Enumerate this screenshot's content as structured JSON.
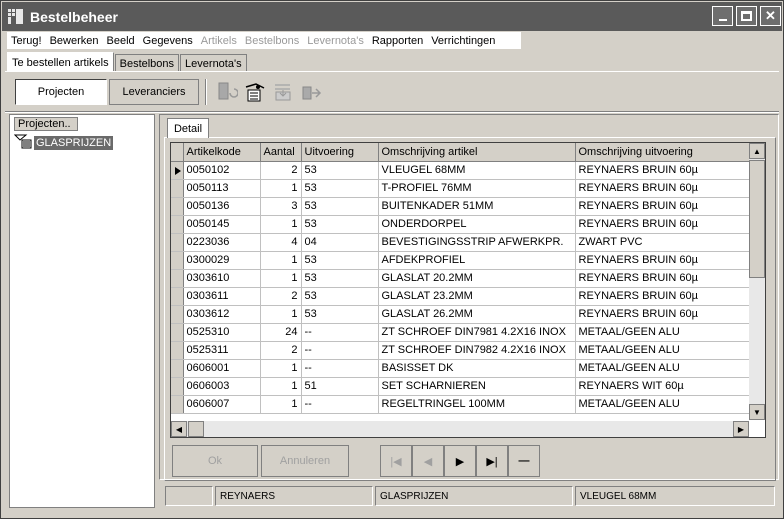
{
  "window": {
    "title": "Bestelbeheer"
  },
  "menu": [
    {
      "label": "Terug!",
      "enabled": true
    },
    {
      "label": "Bewerken",
      "enabled": true
    },
    {
      "label": "Beeld",
      "enabled": true
    },
    {
      "label": "Gegevens",
      "enabled": true
    },
    {
      "label": "Artikels",
      "enabled": false
    },
    {
      "label": "Bestelbons",
      "enabled": false
    },
    {
      "label": "Levernota's",
      "enabled": false
    },
    {
      "label": "Rapporten",
      "enabled": true
    },
    {
      "label": "Verrichtingen",
      "enabled": true
    }
  ],
  "main_tabs": [
    {
      "label": "Te bestellen artikels",
      "active": true
    },
    {
      "label": "Bestelbons",
      "active": false
    },
    {
      "label": "Levernota's",
      "active": false
    }
  ],
  "toolbar": {
    "projecten": "Projecten",
    "leveranciers": "Leveranciers",
    "icons": [
      "add-to-order-icon",
      "order-list-icon",
      "import-icon",
      "send-icon"
    ]
  },
  "tree": {
    "header": "Projecten..",
    "nodes": [
      {
        "label": "GLASPRIJZEN",
        "icon": "project-folder-icon"
      }
    ]
  },
  "detail_tab": "Detail",
  "grid": {
    "columns": [
      "Artikelkode",
      "Aantal",
      "Uitvoering",
      "Omschrijving artikel",
      "Omschrijving uitvoering"
    ],
    "rows": [
      [
        "0050102",
        "2",
        "53",
        "VLEUGEL 68MM",
        "REYNAERS BRUIN 60µ"
      ],
      [
        "0050113",
        "1",
        "53",
        "T-PROFIEL 76MM",
        "REYNAERS BRUIN 60µ"
      ],
      [
        "0050136",
        "3",
        "53",
        "BUITENKADER 51MM",
        "REYNAERS BRUIN 60µ"
      ],
      [
        "0050145",
        "1",
        "53",
        "ONDERDORPEL",
        "REYNAERS BRUIN 60µ"
      ],
      [
        "0223036",
        "4",
        "04",
        "BEVESTIGINGSSTRIP AFWERKPR.",
        "ZWART PVC"
      ],
      [
        "0300029",
        "1",
        "53",
        "AFDEKPROFIEL",
        "REYNAERS BRUIN 60µ"
      ],
      [
        "0303610",
        "1",
        "53",
        "GLASLAT 20.2MM",
        "REYNAERS BRUIN 60µ"
      ],
      [
        "0303611",
        "2",
        "53",
        "GLASLAT 23.2MM",
        "REYNAERS BRUIN 60µ"
      ],
      [
        "0303612",
        "1",
        "53",
        "GLASLAT 26.2MM",
        "REYNAERS BRUIN 60µ"
      ],
      [
        "0525310",
        "24",
        "--",
        "ZT SCHROEF DIN7981 4.2X16 INOX",
        "METAAL/GEEN ALU"
      ],
      [
        "0525311",
        "2",
        "--",
        "ZT SCHROEF DIN7982 4.2X16 INOX",
        "METAAL/GEEN ALU"
      ],
      [
        "0606001",
        "1",
        "--",
        "BASISSET DK",
        "METAAL/GEEN ALU"
      ],
      [
        "0606003",
        "1",
        "51",
        "SET SCHARNIEREN",
        "REYNAERS WIT 60µ"
      ],
      [
        "0606007",
        "1",
        "--",
        "REGELTRINGEL 100MM",
        "METAAL/GEEN ALU"
      ]
    ],
    "current_row": 0
  },
  "buttons": {
    "ok": "Ok",
    "annuleren": "Annuleren",
    "nav_first": "|◀",
    "nav_prev": "◀",
    "nav_next": "▶",
    "nav_last": "▶|",
    "delete": "—"
  },
  "status": [
    "",
    "REYNAERS",
    "GLASPRIJZEN",
    "VLEUGEL 68MM"
  ]
}
